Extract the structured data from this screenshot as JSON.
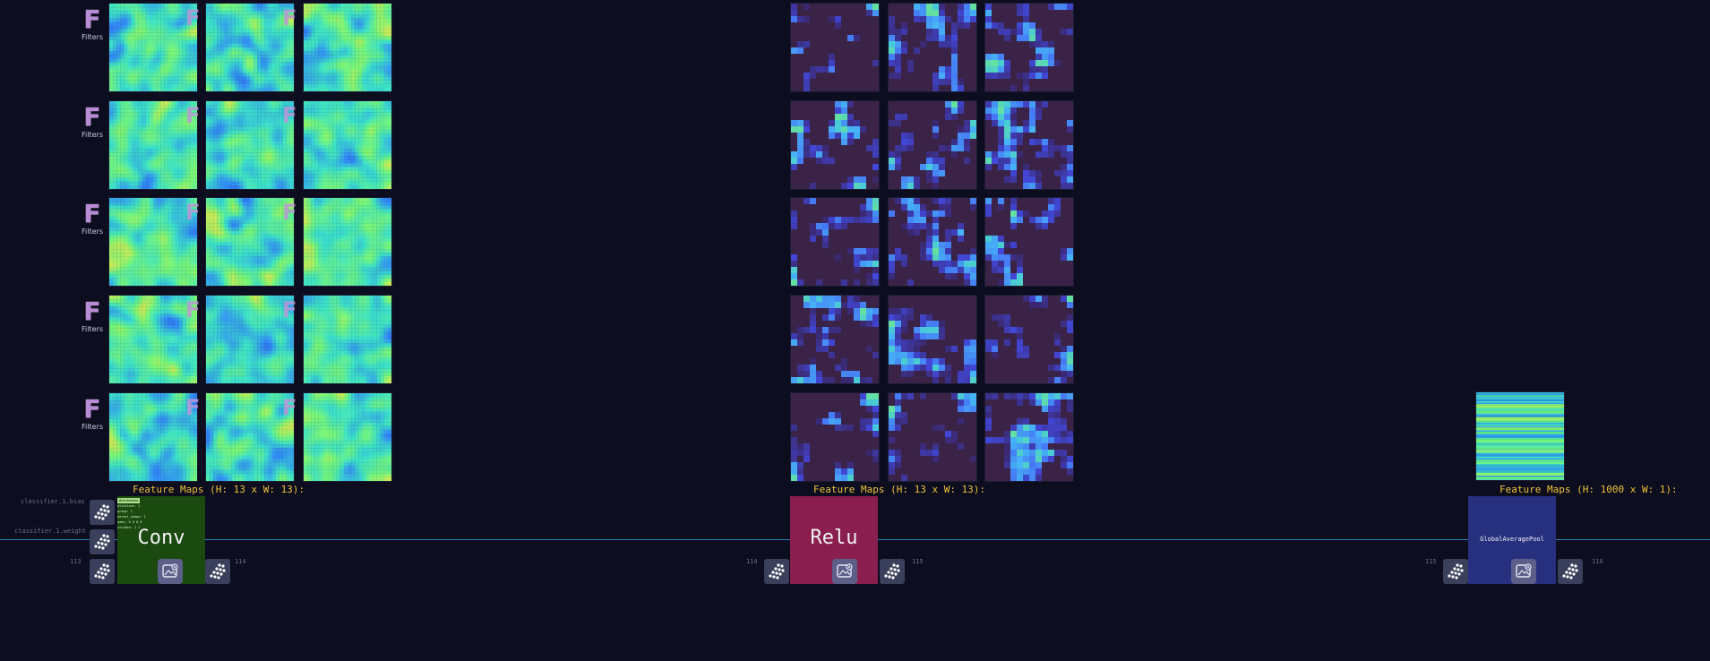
{
  "layers": [
    {
      "type_label": "Conv",
      "color": "#1b4a10",
      "caption": "Feature Maps (H: 13 x W: 13):",
      "input_id": "113",
      "output_id": "114",
      "filter_letter": "F",
      "filter_label": "Filters",
      "map_style": "conv",
      "attributes": {
        "header": "Attributes",
        "lines": [
          "dilations: 1",
          "group: 1",
          "kernel_shape: 1",
          "pads: 0 0 0 0",
          "strides: 1 1"
        ]
      }
    },
    {
      "type_label": "Relu",
      "color": "#8a1f4f",
      "caption": "Feature Maps (H: 13 x W: 13):",
      "input_id": "114",
      "output_id": "115",
      "map_style": "relu"
    },
    {
      "type_label": "GlobalAveragePool",
      "color": "#27307f",
      "caption": "Feature Maps (H: 1000 x W: 1):",
      "input_id": "115",
      "output_id": "116",
      "map_style": "pool"
    }
  ],
  "initializers": {
    "bias": "classifier.1.bias",
    "weight": "classifier.1.weight"
  },
  "icons": {
    "port": "dot-grid-icon",
    "preview": "image-preview-icon"
  },
  "colors": {
    "background": "#0c0d1e",
    "edge": "#2a7fb8",
    "caption": "#f0c23a"
  }
}
